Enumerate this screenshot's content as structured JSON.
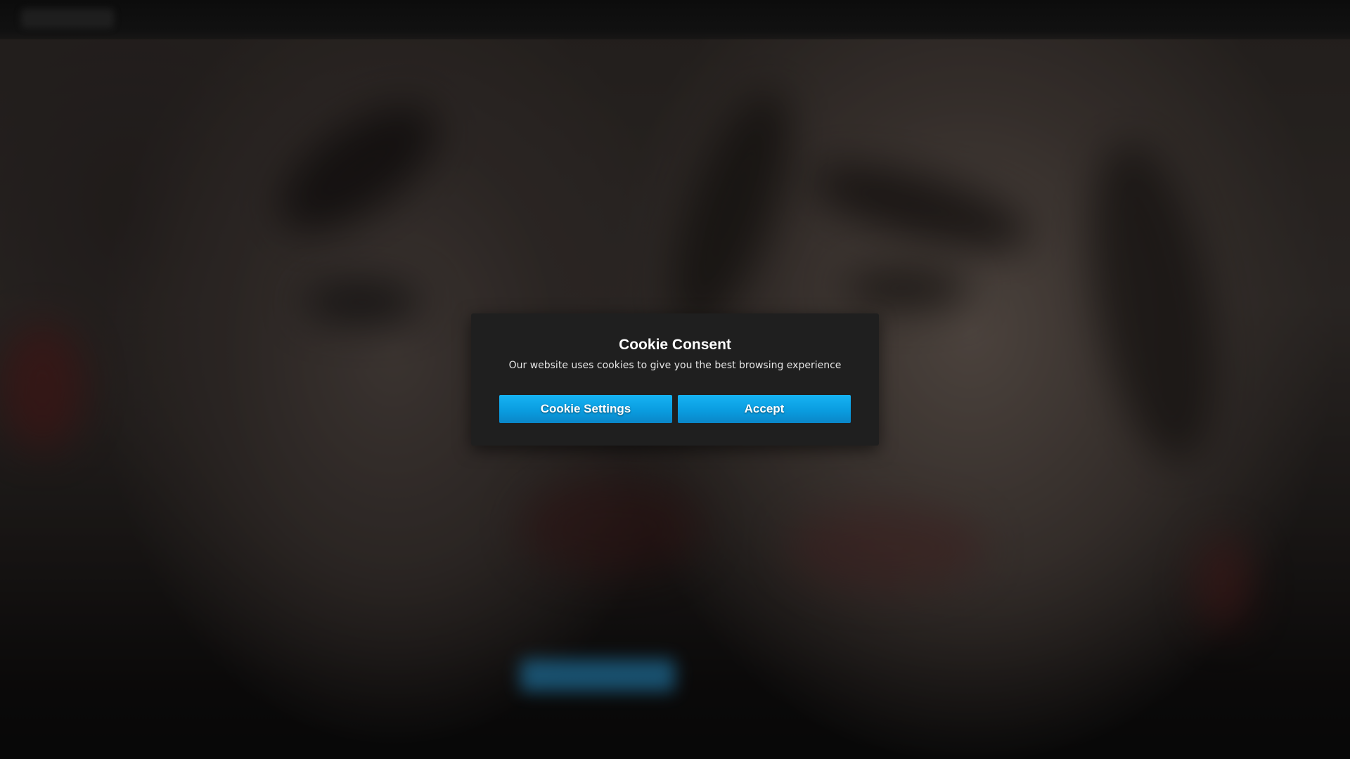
{
  "cookie_modal": {
    "title": "Cookie Consent",
    "message": "Our website uses cookies to give you the best browsing experience",
    "settings_button_label": "Cookie Settings",
    "accept_button_label": "Accept"
  },
  "colors": {
    "modal_background": "#1f1f1f",
    "button_accent": "#0a9de0",
    "page_background": "#0d0d0d"
  },
  "icons": {
    "site_logo": "site-logo"
  }
}
